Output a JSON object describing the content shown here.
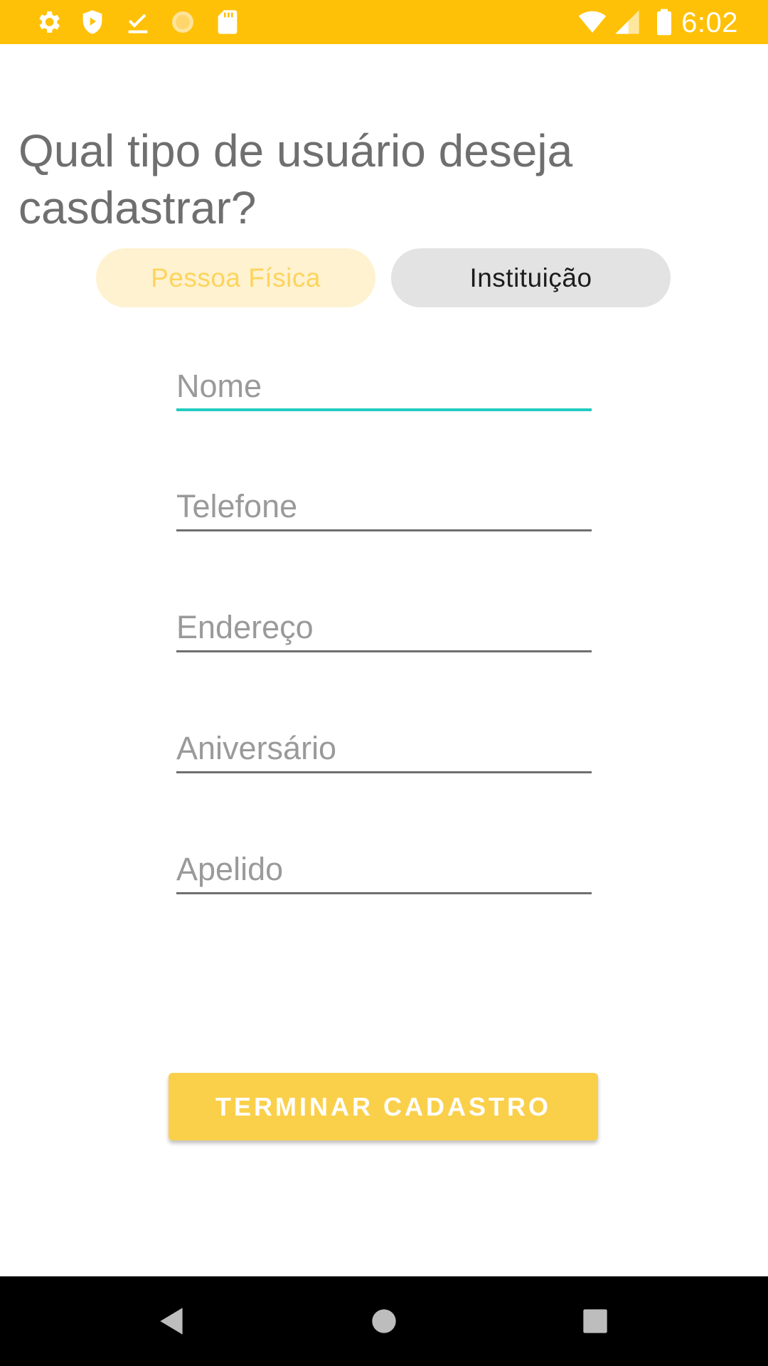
{
  "status_bar": {
    "time": "6:02",
    "left_icons": [
      "gear-icon",
      "shield-play-icon",
      "download-done-icon",
      "sun-icon",
      "sd-card-icon"
    ],
    "right_icons": [
      "wifi-icon",
      "cell-signal-icon",
      "battery-icon"
    ],
    "background_color": "#FFC107"
  },
  "main": {
    "question": "Qual tipo de usuário deseja casdastrar?",
    "toggle": {
      "pessoa_fisica": "Pessoa Física",
      "instituicao": "Instituição",
      "selected": "Pessoa Física"
    },
    "fields": {
      "nome": "Nome",
      "telefone": "Telefone",
      "endereco": "Endereço",
      "aniversario": "Aniversário",
      "apelido": "Apelido"
    },
    "submit_label": "TERMINAR CADASTRO"
  },
  "nav_bar": {
    "icons": [
      "back-triangle-icon",
      "home-circle-icon",
      "recents-square-icon"
    ]
  },
  "colors": {
    "accent": "#FAD04B",
    "focus_underline": "#22CCC0"
  }
}
